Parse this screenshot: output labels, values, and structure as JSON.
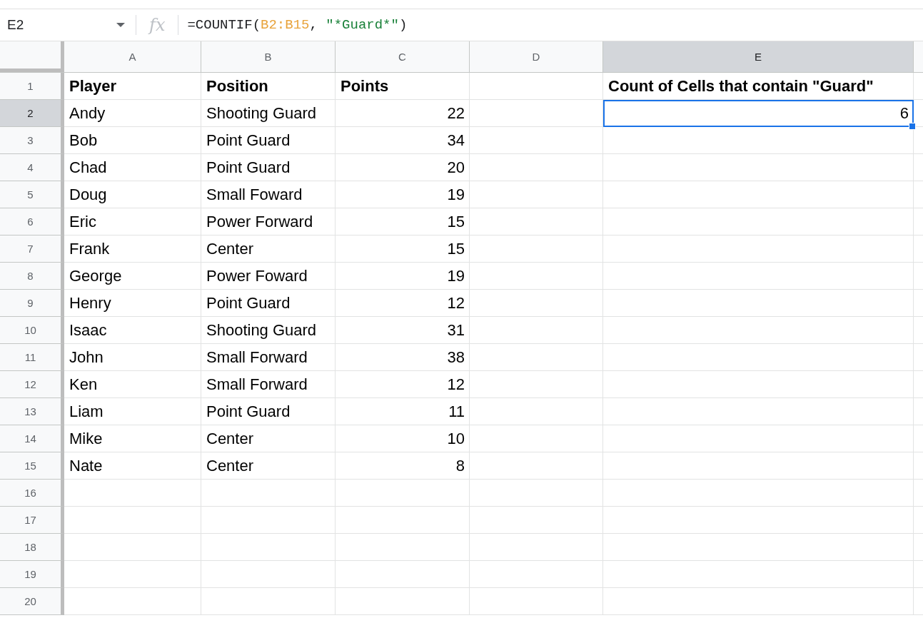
{
  "formula_bar": {
    "name_box": "E2",
    "function_icon": "fx",
    "formula": [
      {
        "kind": "plain",
        "text": "=COUNTIF("
      },
      {
        "kind": "range",
        "text": "B2:B15"
      },
      {
        "kind": "plain",
        "text": ", "
      },
      {
        "kind": "string",
        "text": "\"*Guard*\""
      },
      {
        "kind": "plain",
        "text": ")"
      }
    ]
  },
  "columns": [
    {
      "label": "A",
      "selected": false
    },
    {
      "label": "B",
      "selected": false
    },
    {
      "label": "C",
      "selected": false
    },
    {
      "label": "D",
      "selected": false
    },
    {
      "label": "E",
      "selected": true
    }
  ],
  "rows": [
    {
      "header": "1",
      "selected": false,
      "column_a": {
        "text": "Player",
        "kind": "text",
        "bold": true,
        "selected": false
      },
      "column_b": {
        "text": "Position",
        "kind": "text",
        "bold": true,
        "selected": false
      },
      "column_c": {
        "text": "Points",
        "kind": "text",
        "bold": true,
        "selected": false
      },
      "column_e": {
        "text": "Count of Cells that contain \"Guard\"",
        "kind": "text",
        "bold": true,
        "selected": false
      }
    },
    {
      "header": "2",
      "selected": true,
      "column_a": {
        "text": "Andy",
        "kind": "text",
        "bold": false,
        "selected": false
      },
      "column_b": {
        "text": "Shooting Guard",
        "kind": "text",
        "bold": false,
        "selected": false
      },
      "column_c": {
        "text": "22",
        "kind": "number",
        "bold": false,
        "selected": false
      },
      "column_e": {
        "text": "6",
        "kind": "number",
        "bold": false,
        "selected": true
      }
    },
    {
      "header": "3",
      "selected": false,
      "column_a": {
        "text": "Bob",
        "kind": "text",
        "bold": false,
        "selected": false
      },
      "column_b": {
        "text": "Point Guard",
        "kind": "text",
        "bold": false,
        "selected": false
      },
      "column_c": {
        "text": "34",
        "kind": "number",
        "bold": false,
        "selected": false
      }
    },
    {
      "header": "4",
      "selected": false,
      "column_a": {
        "text": "Chad",
        "kind": "text",
        "bold": false,
        "selected": false
      },
      "column_b": {
        "text": "Point Guard",
        "kind": "text",
        "bold": false,
        "selected": false
      },
      "column_c": {
        "text": "20",
        "kind": "number",
        "bold": false,
        "selected": false
      }
    },
    {
      "header": "5",
      "selected": false,
      "column_a": {
        "text": "Doug",
        "kind": "text",
        "bold": false,
        "selected": false
      },
      "column_b": {
        "text": "Small Foward",
        "kind": "text",
        "bold": false,
        "selected": false
      },
      "column_c": {
        "text": "19",
        "kind": "number",
        "bold": false,
        "selected": false
      }
    },
    {
      "header": "6",
      "selected": false,
      "column_a": {
        "text": "Eric",
        "kind": "text",
        "bold": false,
        "selected": false
      },
      "column_b": {
        "text": "Power Forward",
        "kind": "text",
        "bold": false,
        "selected": false
      },
      "column_c": {
        "text": "15",
        "kind": "number",
        "bold": false,
        "selected": false
      }
    },
    {
      "header": "7",
      "selected": false,
      "column_a": {
        "text": "Frank",
        "kind": "text",
        "bold": false,
        "selected": false
      },
      "column_b": {
        "text": "Center",
        "kind": "text",
        "bold": false,
        "selected": false
      },
      "column_c": {
        "text": "15",
        "kind": "number",
        "bold": false,
        "selected": false
      }
    },
    {
      "header": "8",
      "selected": false,
      "column_a": {
        "text": "George",
        "kind": "text",
        "bold": false,
        "selected": false
      },
      "column_b": {
        "text": "Power Foward",
        "kind": "text",
        "bold": false,
        "selected": false
      },
      "column_c": {
        "text": "19",
        "kind": "number",
        "bold": false,
        "selected": false
      }
    },
    {
      "header": "9",
      "selected": false,
      "column_a": {
        "text": "Henry",
        "kind": "text",
        "bold": false,
        "selected": false
      },
      "column_b": {
        "text": "Point Guard",
        "kind": "text",
        "bold": false,
        "selected": false
      },
      "column_c": {
        "text": "12",
        "kind": "number",
        "bold": false,
        "selected": false
      }
    },
    {
      "header": "10",
      "selected": false,
      "column_a": {
        "text": "Isaac",
        "kind": "text",
        "bold": false,
        "selected": false
      },
      "column_b": {
        "text": "Shooting Guard",
        "kind": "text",
        "bold": false,
        "selected": false
      },
      "column_c": {
        "text": "31",
        "kind": "number",
        "bold": false,
        "selected": false
      }
    },
    {
      "header": "11",
      "selected": false,
      "column_a": {
        "text": "John",
        "kind": "text",
        "bold": false,
        "selected": false
      },
      "column_b": {
        "text": "Small Forward",
        "kind": "text",
        "bold": false,
        "selected": false
      },
      "column_c": {
        "text": "38",
        "kind": "number",
        "bold": false,
        "selected": false
      }
    },
    {
      "header": "12",
      "selected": false,
      "column_a": {
        "text": "Ken",
        "kind": "text",
        "bold": false,
        "selected": false
      },
      "column_b": {
        "text": "Small Forward",
        "kind": "text",
        "bold": false,
        "selected": false
      },
      "column_c": {
        "text": "12",
        "kind": "number",
        "bold": false,
        "selected": false
      }
    },
    {
      "header": "13",
      "selected": false,
      "column_a": {
        "text": "Liam",
        "kind": "text",
        "bold": false,
        "selected": false
      },
      "column_b": {
        "text": "Point Guard",
        "kind": "text",
        "bold": false,
        "selected": false
      },
      "column_c": {
        "text": "11",
        "kind": "number",
        "bold": false,
        "selected": false
      }
    },
    {
      "header": "14",
      "selected": false,
      "column_a": {
        "text": "Mike",
        "kind": "text",
        "bold": false,
        "selected": false
      },
      "column_b": {
        "text": "Center",
        "kind": "text",
        "bold": false,
        "selected": false
      },
      "column_c": {
        "text": "10",
        "kind": "number",
        "bold": false,
        "selected": false
      }
    },
    {
      "header": "15",
      "selected": false,
      "column_a": {
        "text": "Nate",
        "kind": "text",
        "bold": false,
        "selected": false
      },
      "column_b": {
        "text": "Center",
        "kind": "text",
        "bold": false,
        "selected": false
      },
      "column_c": {
        "text": "8",
        "kind": "number",
        "bold": false,
        "selected": false
      }
    },
    {
      "header": "16",
      "selected": false
    },
    {
      "header": "17",
      "selected": false
    },
    {
      "header": "18",
      "selected": false
    },
    {
      "header": "19",
      "selected": false
    },
    {
      "header": "20",
      "selected": false
    }
  ]
}
